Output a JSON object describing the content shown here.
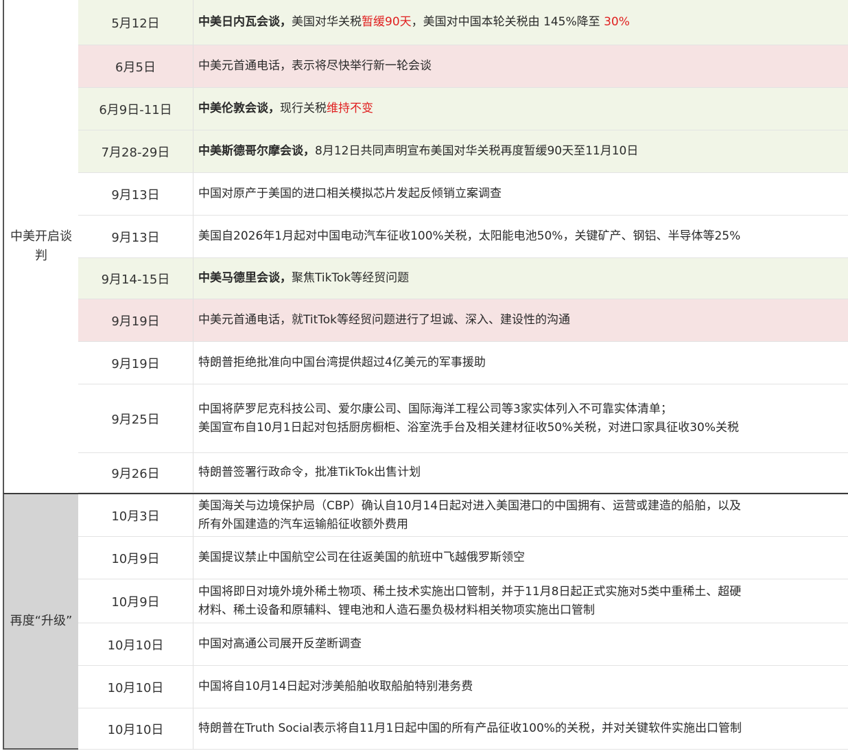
{
  "colors": {
    "green_row": "#f1f5e7",
    "pink_row": "#f6e3e3",
    "white_row": "#ffffff",
    "highlight_red": "#e02020",
    "section2_label_bg": "#d4d4d4"
  },
  "sections": [
    {
      "label": "中美开启谈判",
      "rows": [
        {
          "date": "5月12日",
          "bg": "green",
          "lines": [
            [
              {
                "t": "中美日内瓦会谈，",
                "b": true
              },
              {
                "t": "美国对华关税"
              },
              {
                "t": "暂缓90天",
                "red": true
              },
              {
                "t": "，美国对中国本轮关税由 145%降至 "
              },
              {
                "t": "30%",
                "red": true
              }
            ]
          ]
        },
        {
          "date": "6月5日",
          "bg": "pink",
          "lines": [
            [
              {
                "t": "中美元首通电话，表示将尽快举行新一轮会谈"
              }
            ]
          ]
        },
        {
          "date": "6月9日-11日",
          "bg": "green",
          "lines": [
            [
              {
                "t": "中美伦敦会谈，",
                "b": true
              },
              {
                "t": "现行关税"
              },
              {
                "t": "维持不变",
                "red": true
              }
            ]
          ]
        },
        {
          "date": "7月28-29日",
          "bg": "green",
          "lines": [
            [
              {
                "t": "中美斯德哥尔摩会谈，",
                "b": true
              },
              {
                "t": "8月12日共同声明宣布美国对华关税再度暂缓90天至11月10日"
              }
            ]
          ]
        },
        {
          "date": "9月13日",
          "bg": "white",
          "lines": [
            [
              {
                "t": "中国对原产于美国的进口相关模拟芯片发起反倾销立案调查"
              }
            ]
          ]
        },
        {
          "date": "9月13日",
          "bg": "white",
          "lines": [
            [
              {
                "t": "美国自2026年1月起对中国电动汽车征收100%关税，太阳能电池50%，关键矿产、钢铝、半导体等25%"
              }
            ]
          ]
        },
        {
          "date": "9月14-15日",
          "bg": "green",
          "lines": [
            [
              {
                "t": "中美马德里会谈，",
                "b": true
              },
              {
                "t": "聚焦TikTok等经贸问题"
              }
            ]
          ]
        },
        {
          "date": "9月19日",
          "bg": "pink",
          "lines": [
            [
              {
                "t": "中美元首通电话，就TitTok等经贸问题进行了坦诚、深入、建设性的沟通"
              }
            ]
          ]
        },
        {
          "date": "9月19日",
          "bg": "white",
          "lines": [
            [
              {
                "t": "特朗普拒绝批准向中国台湾提供超过4亿美元的军事援助"
              }
            ]
          ]
        },
        {
          "date": "9月25日",
          "bg": "white",
          "lines": [
            [
              {
                "t": "中国将萨罗尼克科技公司、爱尔康公司、国际海洋工程公司等3家实体列入不可靠实体清单；"
              }
            ],
            [
              {
                "t": "美国宣布自10月1日起对包括厨房橱柜、浴室洗手台及相关建材征收50%关税，对进口家具征收30%关税"
              }
            ]
          ]
        },
        {
          "date": "9月26日",
          "bg": "white",
          "lines": [
            [
              {
                "t": "特朗普签署行政命令，批准TikTok出售计划"
              }
            ]
          ]
        }
      ]
    },
    {
      "label": "再度“升级”",
      "rows": [
        {
          "date": "10月3日",
          "bg": "white",
          "lines": [
            [
              {
                "t": "美国海关与边境保护局（CBP）确认自10月14日起对进入美国港口的中国拥有、运营或建造的船舶，以及"
              }
            ],
            [
              {
                "t": "所有外国建造的汽车运输船征收额外费用"
              }
            ]
          ]
        },
        {
          "date": "10月9日",
          "bg": "white",
          "lines": [
            [
              {
                "t": "美国提议禁止中国航空公司在往返美国的航班中飞越俄罗斯领空"
              }
            ]
          ]
        },
        {
          "date": "10月9日",
          "bg": "white",
          "lines": [
            [
              {
                "t": "中国将即日对境外境外稀土物项、稀土技术实施出口管制，并于11月8日起正式实施对5类中重稀土、超硬"
              }
            ],
            [
              {
                "t": "材料、稀土设备和原辅料、锂电池和人造石墨负极材料相关物项实施出口管制"
              }
            ]
          ]
        },
        {
          "date": "10月10日",
          "bg": "white",
          "lines": [
            [
              {
                "t": "中国对高通公司展开反垄断调查"
              }
            ]
          ]
        },
        {
          "date": "10月10日",
          "bg": "white",
          "lines": [
            [
              {
                "t": "中国将自10月14日起对涉美船舶收取船舶特别港务费"
              }
            ]
          ]
        },
        {
          "date": "10月10日",
          "bg": "white",
          "lines": [
            [
              {
                "t": "特朗普在Truth Social表示将自11月1日起中国的所有产品征收100%的关税，并对关键软件实施出口管制"
              }
            ]
          ]
        }
      ]
    }
  ]
}
